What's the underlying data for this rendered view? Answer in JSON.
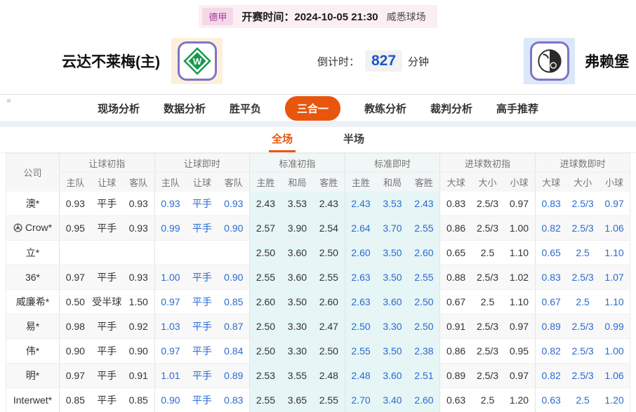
{
  "match_bar": {
    "league": "德甲",
    "kickoff_label": "开赛时间：",
    "kickoff_time": "2024-10-05 21:30",
    "venue": "威悉球场"
  },
  "teams": {
    "home": {
      "name": "云达不莱梅(主)",
      "logo": "werder-bremen-crest"
    },
    "away": {
      "name": "弗赖堡",
      "logo": "freiburg-crest"
    }
  },
  "countdown": {
    "label": "倒计时：",
    "value": "827",
    "unit": "分钟"
  },
  "nav": {
    "items": [
      {
        "label": "现场分析",
        "active": false
      },
      {
        "label": "数据分析",
        "active": false
      },
      {
        "label": "胜平负",
        "active": false
      },
      {
        "label": "三合一",
        "active": true
      },
      {
        "label": "教练分析",
        "active": false
      },
      {
        "label": "裁判分析",
        "active": false
      },
      {
        "label": "高手推荐",
        "active": false
      }
    ]
  },
  "period_tabs": {
    "items": [
      {
        "label": "全场",
        "active": true
      },
      {
        "label": "半场",
        "active": false
      }
    ]
  },
  "table": {
    "company_header": "公司",
    "groups": [
      {
        "label": "让球初指",
        "cols": [
          "主队",
          "让球",
          "客队"
        ],
        "type": "init",
        "tint": false
      },
      {
        "label": "让球即时",
        "cols": [
          "主队",
          "让球",
          "客队"
        ],
        "type": "live",
        "tint": false
      },
      {
        "label": "标准初指",
        "cols": [
          "主胜",
          "和局",
          "客胜"
        ],
        "type": "init",
        "tint": true
      },
      {
        "label": "标准即时",
        "cols": [
          "主胜",
          "和局",
          "客胜"
        ],
        "type": "live",
        "tint": true
      },
      {
        "label": "进球数初指",
        "cols": [
          "大球",
          "大小",
          "小球"
        ],
        "type": "init",
        "tint": false
      },
      {
        "label": "进球数即时",
        "cols": [
          "大球",
          "大小",
          "小球"
        ],
        "type": "live",
        "tint": false
      }
    ],
    "rows": [
      {
        "company": "澳*",
        "icon": false,
        "cells": [
          [
            "0.93",
            "平手",
            "0.93"
          ],
          [
            "0.93",
            "平手",
            "0.93"
          ],
          [
            "2.43",
            "3.53",
            "2.43"
          ],
          [
            "2.43",
            "3.53",
            "2.43"
          ],
          [
            "0.83",
            "2.5/3",
            "0.97"
          ],
          [
            "0.83",
            "2.5/3",
            "0.97"
          ]
        ]
      },
      {
        "company": "Crow*",
        "icon": true,
        "cells": [
          [
            "0.95",
            "平手",
            "0.93"
          ],
          [
            "0.99",
            "平手",
            "0.90"
          ],
          [
            "2.57",
            "3.90",
            "2.54"
          ],
          [
            "2.64",
            "3.70",
            "2.55"
          ],
          [
            "0.86",
            "2.5/3",
            "1.00"
          ],
          [
            "0.82",
            "2.5/3",
            "1.06"
          ]
        ]
      },
      {
        "company": "立*",
        "icon": false,
        "cells": [
          [
            "",
            "",
            ""
          ],
          [
            "",
            "",
            ""
          ],
          [
            "2.50",
            "3.60",
            "2.50"
          ],
          [
            "2.60",
            "3.50",
            "2.60"
          ],
          [
            "0.65",
            "2.5",
            "1.10"
          ],
          [
            "0.65",
            "2.5",
            "1.10"
          ]
        ]
      },
      {
        "company": "36*",
        "icon": false,
        "cells": [
          [
            "0.97",
            "平手",
            "0.93"
          ],
          [
            "1.00",
            "平手",
            "0.90"
          ],
          [
            "2.55",
            "3.60",
            "2.55"
          ],
          [
            "2.63",
            "3.50",
            "2.55"
          ],
          [
            "0.88",
            "2.5/3",
            "1.02"
          ],
          [
            "0.83",
            "2.5/3",
            "1.07"
          ]
        ]
      },
      {
        "company": "威廉希*",
        "icon": false,
        "cells": [
          [
            "0.50",
            "受半球",
            "1.50"
          ],
          [
            "0.97",
            "平手",
            "0.85"
          ],
          [
            "2.60",
            "3.50",
            "2.60"
          ],
          [
            "2.63",
            "3.60",
            "2.50"
          ],
          [
            "0.67",
            "2.5",
            "1.10"
          ],
          [
            "0.67",
            "2.5",
            "1.10"
          ]
        ]
      },
      {
        "company": "易*",
        "icon": false,
        "cells": [
          [
            "0.98",
            "平手",
            "0.92"
          ],
          [
            "1.03",
            "平手",
            "0.87"
          ],
          [
            "2.50",
            "3.30",
            "2.47"
          ],
          [
            "2.50",
            "3.30",
            "2.50"
          ],
          [
            "0.91",
            "2.5/3",
            "0.97"
          ],
          [
            "0.89",
            "2.5/3",
            "0.99"
          ]
        ]
      },
      {
        "company": "伟*",
        "icon": false,
        "cells": [
          [
            "0.90",
            "平手",
            "0.90"
          ],
          [
            "0.97",
            "平手",
            "0.84"
          ],
          [
            "2.50",
            "3.30",
            "2.50"
          ],
          [
            "2.55",
            "3.50",
            "2.38"
          ],
          [
            "0.86",
            "2.5/3",
            "0.95"
          ],
          [
            "0.82",
            "2.5/3",
            "1.00"
          ]
        ]
      },
      {
        "company": "明*",
        "icon": false,
        "cells": [
          [
            "0.97",
            "平手",
            "0.91"
          ],
          [
            "1.01",
            "平手",
            "0.89"
          ],
          [
            "2.53",
            "3.55",
            "2.48"
          ],
          [
            "2.48",
            "3.60",
            "2.51"
          ],
          [
            "0.89",
            "2.5/3",
            "0.97"
          ],
          [
            "0.82",
            "2.5/3",
            "1.06"
          ]
        ]
      },
      {
        "company": "Interwet*",
        "icon": false,
        "cells": [
          [
            "0.85",
            "平手",
            "0.85"
          ],
          [
            "0.90",
            "平手",
            "0.83"
          ],
          [
            "2.55",
            "3.65",
            "2.55"
          ],
          [
            "2.70",
            "3.40",
            "2.60"
          ],
          [
            "0.63",
            "2.5",
            "1.20"
          ],
          [
            "0.63",
            "2.5",
            "1.20"
          ]
        ]
      }
    ]
  },
  "colors": {
    "accent_orange": "#e8560e",
    "live_blue": "#2b6bd0",
    "countdown_blue": "#1c57c5",
    "tint_cyan": "#e6f5f6",
    "league_badge_bg": "#f5d8e8",
    "league_badge_text": "#a43a9b",
    "strip_pink": "#fbeff3"
  }
}
